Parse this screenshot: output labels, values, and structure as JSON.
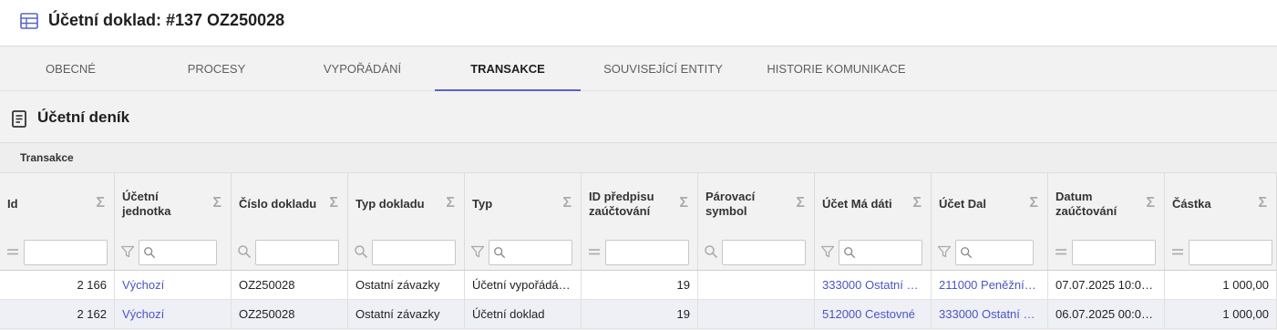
{
  "header": {
    "title": "Účetní doklad: #137 OZ250028",
    "icon": "table-icon"
  },
  "tabs": [
    {
      "label": "OBECNÉ",
      "active": false
    },
    {
      "label": "PROCESY",
      "active": false
    },
    {
      "label": "VYPOŘÁDÁNÍ",
      "active": false
    },
    {
      "label": "TRANSAKCE",
      "active": true
    },
    {
      "label": "SOUVISEJÍCÍ ENTITY",
      "active": false
    },
    {
      "label": "HISTORIE KOMUNIKACE",
      "active": false
    }
  ],
  "section": {
    "title": "Účetní deník",
    "icon": "journal-icon"
  },
  "subheader": {
    "label": "Transakce"
  },
  "columns": [
    {
      "label": "Id",
      "sigma": "Σ",
      "filter": "equals-icon"
    },
    {
      "label": "Účetní jednotka",
      "sigma": "Σ",
      "filter": "funnel-icon"
    },
    {
      "label": "Číslo dokladu",
      "sigma": "Σ",
      "filter": "search-icon"
    },
    {
      "label": "Typ dokladu",
      "sigma": "Σ",
      "filter": "search-icon"
    },
    {
      "label": "Typ",
      "sigma": "Σ",
      "filter": "funnel-icon"
    },
    {
      "label": "ID předpisu zaúčtování",
      "sigma": "Σ",
      "filter": "equals-icon"
    },
    {
      "label": "Párovací symbol",
      "sigma": "Σ",
      "filter": "search-icon"
    },
    {
      "label": "Účet Má dáti",
      "sigma": "Σ",
      "filter": "funnel-icon"
    },
    {
      "label": "Účet Dal",
      "sigma": "Σ",
      "filter": "funnel-icon"
    },
    {
      "label": "Datum zaúčtování",
      "sigma": "Σ",
      "filter": "equals-icon"
    },
    {
      "label": "Částka",
      "sigma": "Σ",
      "filter": "equals-icon"
    }
  ],
  "rows": [
    [
      "2 166",
      "Výchozí",
      "OZ250028",
      "Ostatní závazky",
      "Účetní vypořádá…",
      "19",
      "",
      "333000 Ostatní …",
      "211000 Peněžní…",
      "07.07.2025 10:0…",
      "1 000,00"
    ],
    [
      "2 162",
      "Výchozí",
      "OZ250028",
      "Ostatní závazky",
      "Účetní doklad",
      "19",
      "",
      "512000 Cestovné",
      "333000 Ostatní …",
      "06.07.2025 00:0…",
      "1 000,00"
    ]
  ],
  "colors": {
    "accent": "#5a63c8",
    "link": "#4a55c4",
    "rowAlt": "#eef0f6"
  }
}
